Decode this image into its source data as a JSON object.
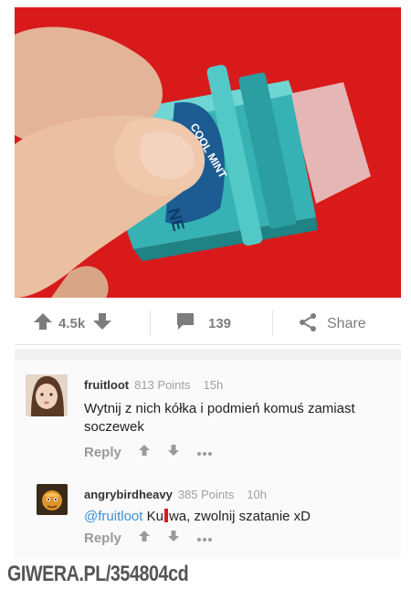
{
  "post": {
    "image_label_top": "COOL MINT",
    "image_label_side": "NE"
  },
  "actions": {
    "upvotes": "4.5k",
    "comments": "139",
    "share_label": "Share"
  },
  "comments": [
    {
      "user": "fruitloot",
      "points": "813 Points",
      "time": "15h",
      "text": "Wytnij z nich kółka i podmień komuś zamiast soczewek",
      "reply_label": "Reply"
    },
    {
      "user": "angrybirdheavy",
      "points": "385 Points",
      "time": "10h",
      "mention": "@fruitloot",
      "text_start": "Ku",
      "text_end": "wa, zwolnij szatanie xD",
      "reply_label": "Reply"
    }
  ],
  "watermark": "GIWERA.PL/354804cd",
  "colors": {
    "background_red": "#d81a1a",
    "mention_blue": "#3b8fd9",
    "muted_gray": "#9a9a9a"
  }
}
